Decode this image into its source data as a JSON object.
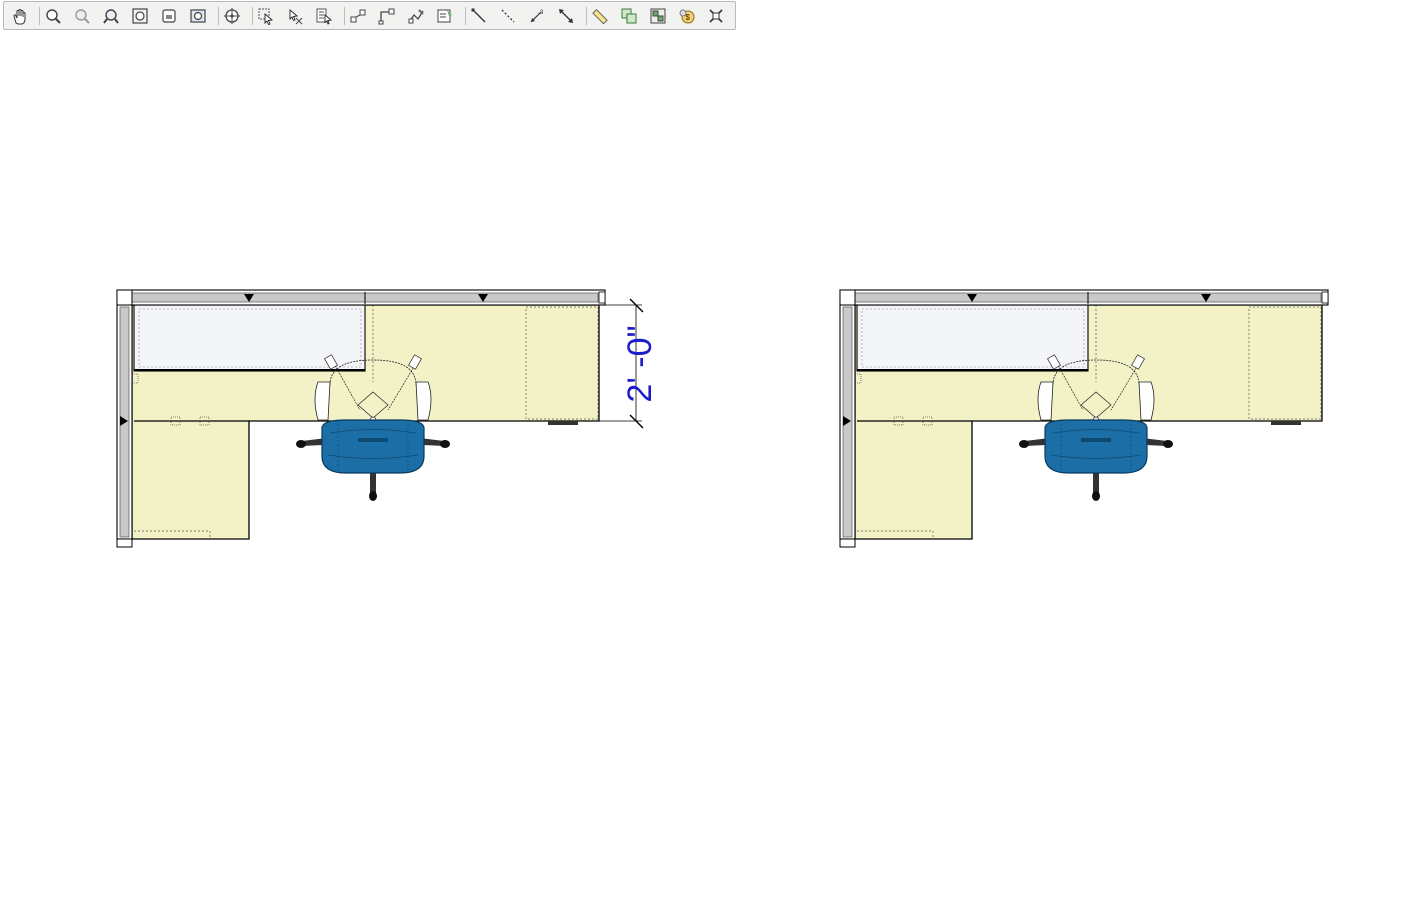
{
  "toolbar": {
    "tools": [
      {
        "name": "pan-tool",
        "icon": "hand-icon",
        "group": 0
      },
      {
        "name": "zoom-tool",
        "icon": "zoom-icon",
        "group": 1
      },
      {
        "name": "zoom-out-tool",
        "icon": "zoom-out-icon",
        "group": 1
      },
      {
        "name": "zoom-window-tool",
        "icon": "zoom-window-icon",
        "group": 1
      },
      {
        "name": "zoom-extents-tool",
        "icon": "zoom-extents-icon",
        "group": 1
      },
      {
        "name": "zoom-selected-tool",
        "icon": "zoom-selected-icon",
        "group": 1
      },
      {
        "name": "zoom-all-tool",
        "icon": "zoom-all-icon",
        "group": 1
      },
      {
        "name": "center-view-tool",
        "icon": "center-view-icon",
        "group": 2
      },
      {
        "name": "select-tool",
        "icon": "select-icon",
        "group": 3
      },
      {
        "name": "deselect-tool",
        "icon": "deselect-icon",
        "group": 3
      },
      {
        "name": "select-by-list-tool",
        "icon": "select-list-icon",
        "group": 3
      },
      {
        "name": "move-tool",
        "icon": "move-icon",
        "group": 4
      },
      {
        "name": "rotate-tool",
        "icon": "rotate-icon",
        "group": 4
      },
      {
        "name": "edit-tool",
        "icon": "edit-icon",
        "group": 4
      },
      {
        "name": "properties-tool",
        "icon": "properties-icon",
        "group": 4
      },
      {
        "name": "line-tool",
        "icon": "line-icon",
        "group": 5
      },
      {
        "name": "dashed-line-tool",
        "icon": "dashed-line-icon",
        "group": 5
      },
      {
        "name": "dimension-tool",
        "icon": "dimension-icon",
        "group": 5
      },
      {
        "name": "dimension-arrow-tool",
        "icon": "dimension-arrow-icon",
        "group": 5
      },
      {
        "name": "measure-tool",
        "icon": "ruler-icon",
        "group": 6
      },
      {
        "name": "copy-tool",
        "icon": "copy-icon",
        "group": 6
      },
      {
        "name": "group-tool",
        "icon": "group-icon",
        "group": 6
      },
      {
        "name": "pricing-tool",
        "icon": "pricing-icon",
        "group": 6
      },
      {
        "name": "delete-tool",
        "icon": "delete-icon",
        "group": 6
      }
    ]
  },
  "drawing": {
    "dimension_label": "2' -0\"",
    "colors": {
      "worksurface": "#f2f2c6",
      "storage": "#f4f5f9",
      "panel": "#c9c9c9",
      "chair": "#1b6ea6",
      "dimension": "#1c1ccc",
      "line": "#000000"
    }
  }
}
